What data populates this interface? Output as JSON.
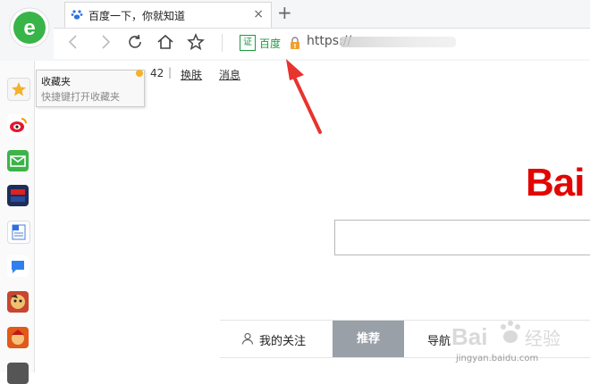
{
  "browser": {
    "tab_title": "百度一下，你就知道",
    "new_tab_symbol": "+",
    "close_symbol": "×",
    "cert_label": "证",
    "site_name": "百度",
    "url": "https://"
  },
  "sidebar": {
    "tooltip_title": "收藏夹",
    "tooltip_subtitle": "快捷键打开收藏夹",
    "icons": [
      "star-icon",
      "weibo-icon",
      "mail-icon",
      "huanqiu-icon",
      "word-doc-icon",
      "chat-icon",
      "game-icon",
      "game2-icon"
    ]
  },
  "baidu": {
    "count": "42",
    "separator": "|",
    "skin_link": "换肤",
    "message_link": "消息",
    "logo_text": "Bai"
  },
  "feed_tabs": {
    "follow": "我的关注",
    "recommend": "推荐",
    "nav": "导航"
  },
  "watermark": {
    "text": "jingyan.baidu.com"
  },
  "colors": {
    "baidu_red": "#e10602",
    "browser_green": "#1a9b40",
    "annotation_arrow": "#e8332f"
  }
}
